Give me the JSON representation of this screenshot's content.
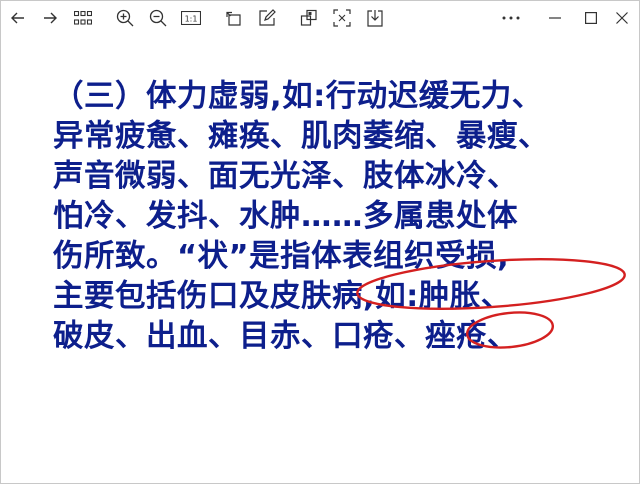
{
  "toolbar": {
    "buttons": [
      {
        "name": "back-button",
        "icon": "arrow-left-icon"
      },
      {
        "name": "forward-button",
        "icon": "arrow-right-icon"
      },
      {
        "name": "thumbnails-button",
        "icon": "grid-icon"
      },
      {
        "name": "zoom-in-button",
        "icon": "zoom-in-icon"
      },
      {
        "name": "zoom-out-button",
        "icon": "zoom-out-icon"
      },
      {
        "name": "actual-size-button",
        "icon": "actual-size-icon"
      },
      {
        "name": "rotate-button",
        "icon": "rotate-icon"
      },
      {
        "name": "edit-button",
        "icon": "edit-icon"
      },
      {
        "name": "crop-button",
        "icon": "crop-icon"
      },
      {
        "name": "fullscreen-button",
        "icon": "fullscreen-icon"
      },
      {
        "name": "save-button",
        "icon": "download-icon"
      },
      {
        "name": "more-button",
        "icon": "more-icon"
      },
      {
        "name": "minimize-button",
        "icon": "minimize-icon"
      },
      {
        "name": "maximize-button",
        "icon": "maximize-icon"
      },
      {
        "name": "close-button",
        "icon": "close-icon"
      }
    ],
    "actual_size_label": "1:1"
  },
  "slide": {
    "lines": [
      "（三）体力虚弱,如:行动迟缓无力、",
      "异常疲惫、瘫痪、肌肉萎缩、暴瘦、",
      "声音微弱、面无光泽、肢体冰冷、",
      "怕冷、发抖、水肿……多属患处体",
      "伤所致。“状”是指体表组织受损,",
      "主要包括伤口及皮肤病,如:肿胀、",
      "破皮、出血、目赤、口疮、痤疮、"
    ],
    "text_color": "#0d1f8c",
    "annotation_color": "#d42020"
  }
}
